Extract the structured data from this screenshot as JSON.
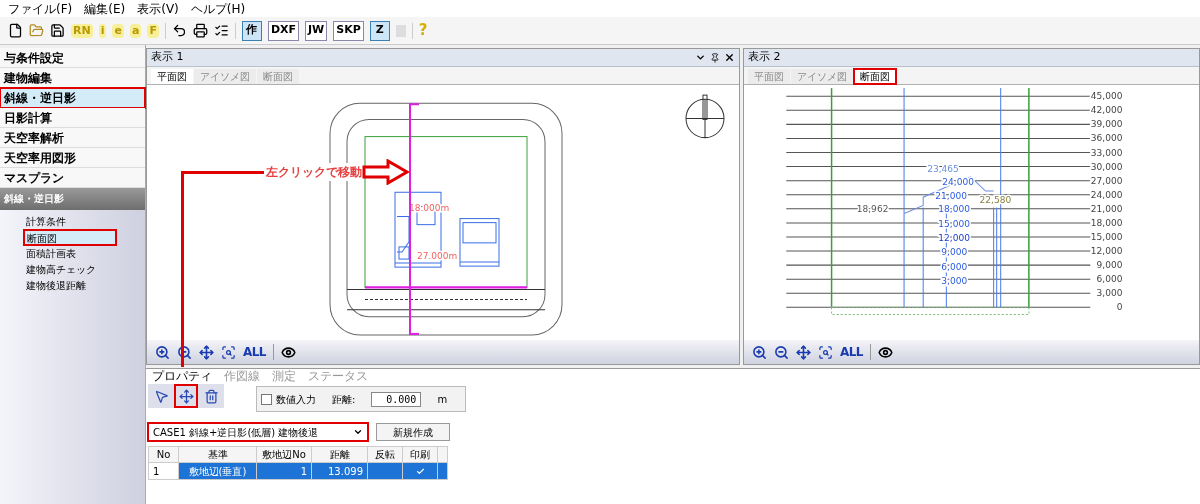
{
  "menu": [
    {
      "label": "ファイル(F)"
    },
    {
      "label": "編集(E)"
    },
    {
      "label": "表示(V)"
    },
    {
      "label": "ヘルプ(H)"
    }
  ],
  "toolbar": {
    "glyph_buttons": [
      {
        "label": "RN"
      },
      {
        "label": "i"
      },
      {
        "label": "e"
      },
      {
        "label": "a"
      },
      {
        "label": "F"
      }
    ],
    "export_buttons": [
      {
        "label": "作",
        "pressed": true
      },
      {
        "label": "DXF",
        "pressed": false
      },
      {
        "label": "JW",
        "pressed": false
      },
      {
        "label": "SKP",
        "pressed": false
      },
      {
        "label": "Z",
        "pressed": true
      }
    ],
    "help": "?"
  },
  "sidebar": {
    "items": [
      {
        "label": "与条件設定",
        "selected": false,
        "annotated": false
      },
      {
        "label": "建物編集",
        "selected": false,
        "annotated": false
      },
      {
        "label": "斜線・逆日影",
        "selected": true,
        "annotated": true
      },
      {
        "label": "日影計算",
        "selected": false,
        "annotated": false
      },
      {
        "label": "天空率解析",
        "selected": false,
        "annotated": false
      },
      {
        "label": "天空率用図形",
        "selected": false,
        "annotated": false
      },
      {
        "label": "マスプラン",
        "selected": false,
        "annotated": false
      }
    ],
    "section": {
      "title": "斜線・逆日影",
      "items": [
        {
          "label": "計算条件",
          "selected": false,
          "annotated": false
        },
        {
          "label": "断面図",
          "selected": true,
          "annotated": true
        },
        {
          "label": "面積計画表",
          "selected": false,
          "annotated": false
        },
        {
          "label": "建物高チェック",
          "selected": false,
          "annotated": false
        },
        {
          "label": "建物後退距離",
          "selected": false,
          "annotated": false
        }
      ]
    }
  },
  "view1": {
    "title": "表示 1",
    "tabs": [
      {
        "label": "平面図",
        "selected": true,
        "annotated": false
      },
      {
        "label": "アイソメ図",
        "selected": false,
        "annotated": false
      },
      {
        "label": "断面図",
        "selected": false,
        "annotated": false
      }
    ],
    "labels": [
      "18.000m",
      "27.000m"
    ],
    "zoom_all": "ALL"
  },
  "view2": {
    "title": "表示 2",
    "tabs": [
      {
        "label": "平面図",
        "selected": false,
        "annotated": false
      },
      {
        "label": "アイソメ図",
        "selected": false,
        "annotated": false
      },
      {
        "label": "断面図",
        "selected": true,
        "annotated": true
      }
    ],
    "height_labels": [
      "45,000",
      "42,000",
      "39,000",
      "36,000",
      "33,000",
      "30,000",
      "27,000",
      "24,000",
      "21,000",
      "18,000",
      "15,000",
      "12,000",
      "9,000",
      "6,000",
      "3,000",
      "0"
    ],
    "inner_labels": [
      "23,465",
      "24,000",
      "21,000",
      "22,580",
      "18,962",
      "18,000",
      "15,000",
      "12,000",
      "9,000",
      "6,000",
      "3,000"
    ],
    "zoom_all": "ALL"
  },
  "annotation": "左クリックで移動",
  "properties": {
    "tabs": [
      {
        "label": "プロパティ",
        "selected": true
      },
      {
        "label": "作図線",
        "selected": false
      },
      {
        "label": "測定",
        "selected": false
      },
      {
        "label": "ステータス",
        "selected": false
      }
    ],
    "tools": [
      {
        "kind": "pointer",
        "annotated": false
      },
      {
        "kind": "section_line",
        "annotated": true
      },
      {
        "kind": "delete",
        "annotated": false
      }
    ],
    "numeric_input": {
      "label": "数値入力",
      "checked": false
    },
    "distance": {
      "label": "距離:",
      "value": "0.000",
      "unit": "m"
    },
    "case_select": {
      "value": "CASE1 斜線+逆日影(低層) 建物後退",
      "annotated": true
    },
    "new_button": "新規作成",
    "table": {
      "columns": [
        "No",
        "基準",
        "敷地辺No",
        "距離",
        "反転",
        "印刷"
      ],
      "rows": [
        {
          "cells": [
            "1",
            "敷地辺(垂直)",
            "1",
            "13.099",
            "",
            ""
          ],
          "selected": true,
          "print": true
        }
      ]
    }
  }
}
